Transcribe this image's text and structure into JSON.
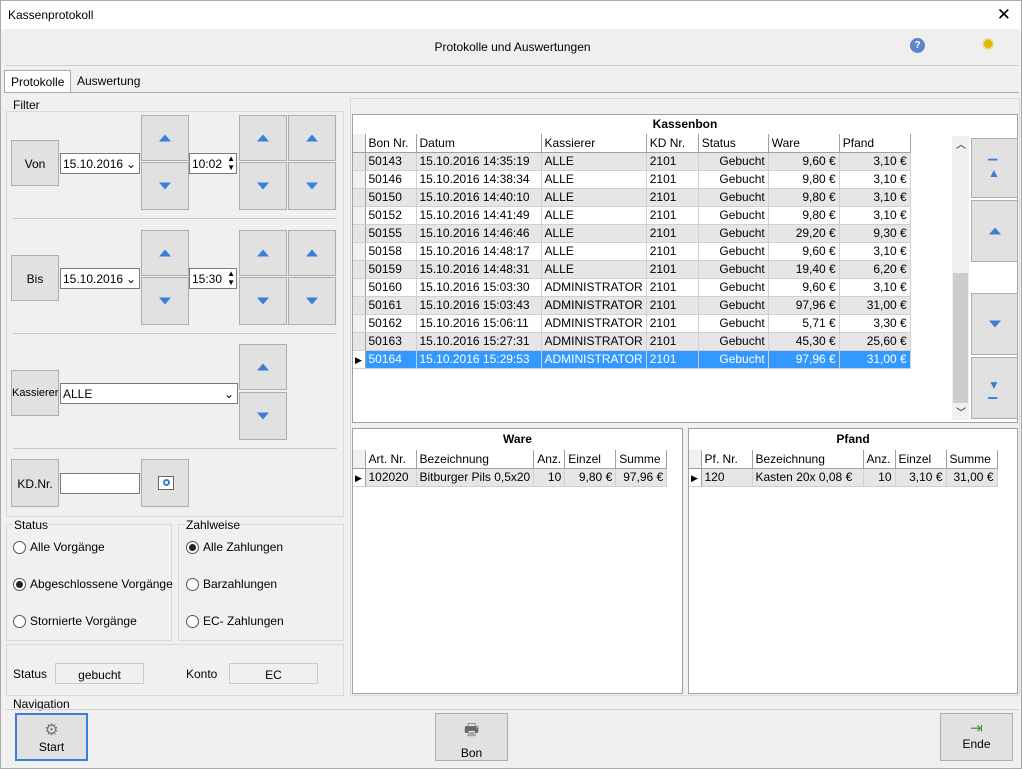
{
  "window": {
    "title": "Kassenprotokoll",
    "header": "Protokolle und Auswertungen"
  },
  "tabs": [
    "Protokolle",
    "Auswertung"
  ],
  "filter": {
    "label": "Filter",
    "von_label": "Von",
    "von_date": "15.10.2016",
    "von_time": "10:02",
    "bis_label": "Bis",
    "bis_date": "15.10.2016",
    "bis_time": "15:30",
    "kassierer_label": "Kassierer",
    "kassierer_value": "ALLE",
    "kdnr_label": "KD.Nr.",
    "kdnr_value": ""
  },
  "status_group": {
    "label": "Status",
    "options": [
      "Alle Vorgänge",
      "Abgeschlossene Vorgänge",
      "Stornierte Vorgänge"
    ],
    "selected": 1
  },
  "zahlweise_group": {
    "label": "Zahlweise",
    "options": [
      "Alle Zahlungen",
      "Barzahlungen",
      "EC- Zahlungen"
    ],
    "selected": 0
  },
  "info": {
    "status_label": "Status",
    "status_value": "gebucht",
    "konto_label": "Konto",
    "konto_value": "EC"
  },
  "kassenbon": {
    "title": "Kassenbon",
    "columns": [
      "Bon Nr.",
      "Datum",
      "Kassierer",
      "KD Nr.",
      "Status",
      "Ware",
      "Pfand"
    ],
    "rows": [
      [
        "50143",
        "15.10.2016 14:35:19",
        "ALLE",
        "2101",
        "Gebucht",
        "9,60 €",
        "3,10 €"
      ],
      [
        "50146",
        "15.10.2016 14:38:34",
        "ALLE",
        "2101",
        "Gebucht",
        "9,80 €",
        "3,10 €"
      ],
      [
        "50150",
        "15.10.2016 14:40:10",
        "ALLE",
        "2101",
        "Gebucht",
        "9,80 €",
        "3,10 €"
      ],
      [
        "50152",
        "15.10.2016 14:41:49",
        "ALLE",
        "2101",
        "Gebucht",
        "9,80 €",
        "3,10 €"
      ],
      [
        "50155",
        "15.10.2016 14:46:46",
        "ALLE",
        "2101",
        "Gebucht",
        "29,20 €",
        "9,30 €"
      ],
      [
        "50158",
        "15.10.2016 14:48:17",
        "ALLE",
        "2101",
        "Gebucht",
        "9,60 €",
        "3,10 €"
      ],
      [
        "50159",
        "15.10.2016 14:48:31",
        "ALLE",
        "2101",
        "Gebucht",
        "19,40 €",
        "6,20 €"
      ],
      [
        "50160",
        "15.10.2016 15:03:30",
        "ADMINISTRATOR",
        "2101",
        "Gebucht",
        "9,60 €",
        "3,10 €"
      ],
      [
        "50161",
        "15.10.2016 15:03:43",
        "ADMINISTRATOR",
        "2101",
        "Gebucht",
        "97,96 €",
        "31,00 €"
      ],
      [
        "50162",
        "15.10.2016 15:06:11",
        "ADMINISTRATOR",
        "2101",
        "Gebucht",
        "5,71 €",
        "3,30 €"
      ],
      [
        "50163",
        "15.10.2016 15:27:31",
        "ADMINISTRATOR",
        "2101",
        "Gebucht",
        "45,30 €",
        "25,60 €"
      ],
      [
        "50164",
        "15.10.2016 15:29:53",
        "ADMINISTRATOR",
        "2101",
        "Gebucht",
        "97,96 €",
        "31,00 €"
      ]
    ],
    "selected_row": 11
  },
  "ware": {
    "title": "Ware",
    "columns": [
      "Art. Nr.",
      "Bezeichnung",
      "Anz.",
      "Einzel",
      "Summe"
    ],
    "rows": [
      [
        "102020",
        "Bitburger Pils 0,5x20",
        "10",
        "9,80 €",
        "97,96 €"
      ]
    ]
  },
  "pfand": {
    "title": "Pfand",
    "columns": [
      "Pf. Nr.",
      "Bezeichnung",
      "Anz.",
      "Einzel",
      "Summe"
    ],
    "rows": [
      [
        "120",
        "Kasten 20x 0,08 €",
        "10",
        "3,10 €",
        "31,00 €"
      ]
    ]
  },
  "navigation": {
    "label": "Navigation",
    "start": "Start",
    "bon": "Bon",
    "ende": "Ende"
  },
  "icons": {
    "help": "help-icon",
    "settings": "sun-icon",
    "search": "search-icon"
  }
}
